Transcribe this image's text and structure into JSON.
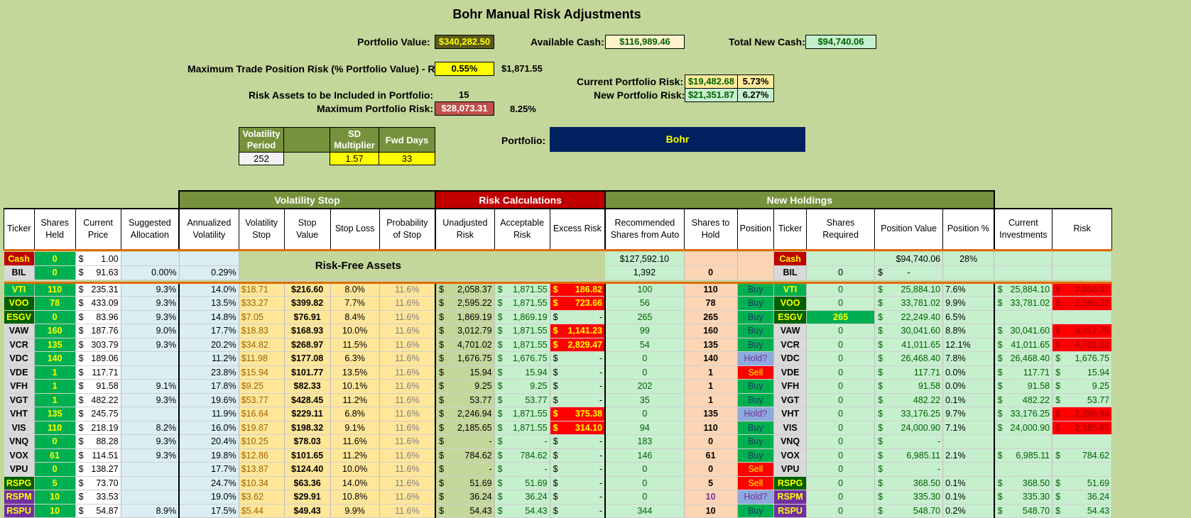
{
  "title": "Bohr Manual Risk Adjustments",
  "top": {
    "portfolio_value_label": "Portfolio Value:",
    "portfolio_value": "$340,282.50",
    "available_cash_label": "Available Cash:",
    "available_cash": "$116,989.46",
    "total_new_cash_label": "Total New Cash:",
    "total_new_cash": "$94,740.06",
    "max_trade_risk_label": "Maximum Trade Position Risk (% Portfolio Value) - R:",
    "max_trade_risk_pct": "0.55%",
    "max_trade_risk_amt": "$1,871.55",
    "current_risk_label": "Current Portfolio Risk:",
    "current_risk_amt": "$19,482.68",
    "current_risk_pct": "5.73%",
    "new_risk_label": "New Portfolio Risk:",
    "new_risk_amt": "$21,351.87",
    "new_risk_pct": "6.27%",
    "risk_assets_label": "Risk Assets to be Included in Portfolio:",
    "risk_assets": "15",
    "max_portfolio_risk_label": "Maximum Portfolio Risk:",
    "max_portfolio_risk_amt": "$28,073.31",
    "max_portfolio_risk_pct": "8.25%",
    "portfolio_label": "Portfolio:",
    "portfolio_name": "Bohr"
  },
  "vol_params": {
    "h_period": "Volatility Period",
    "h_sd": "SD Multiplier",
    "h_fwd": "Fwd Days",
    "period": "252",
    "sd": "1.57",
    "fwd": "33"
  },
  "groups": {
    "volatility_stop": "Volatility Stop",
    "risk_calc": "Risk Calculations",
    "new_holdings": "New Holdings",
    "risk_free": "Risk-Free Assets"
  },
  "headers": [
    "Ticker",
    "Shares Held",
    "Current Price",
    "Suggested Allocation",
    "Annualized Volatility",
    "Volatility Stop",
    "Stop Value",
    "Stop Loss",
    "Probability of Stop",
    "Unadjusted Risk",
    "Acceptable Risk",
    "Excess Risk",
    "Recommended Shares from Auto",
    "Shares to Hold",
    "Position",
    "Ticker",
    "Shares Required",
    "Position Value",
    "Position %",
    "Current Investments",
    "Risk"
  ],
  "cash_row": {
    "ticker": "Cash",
    "shares": "0",
    "price": "1.00",
    "rec": "$127,592.10",
    "ticker2": "Cash",
    "pos_value": "$94,740.06",
    "pos_pct": "28%"
  },
  "bil_row": {
    "ticker": "BIL",
    "shares": "0",
    "price": "91.63",
    "alloc": "0.00%",
    "vol": "0.29%",
    "rec": "1,392",
    "hold": "0",
    "ticker2": "BIL",
    "req": "0",
    "pos_value": "-"
  },
  "rows": [
    {
      "t": "VTI",
      "s": "110",
      "p": "235.31",
      "a": "9.3%",
      "v": "14.0%",
      "vs": "$18.71",
      "sv": "$216.60",
      "sl": "8.0%",
      "pr": "11.6%",
      "ur": "2,058.37",
      "ar": "1,871.55",
      "er": "186.82",
      "rec": "100",
      "h": "110",
      "pos": "Buy",
      "req": "0",
      "pv": "25,884.10",
      "pp": "7.6%",
      "ci": "25,884.10",
      "rk": "2,058.37"
    },
    {
      "t": "VOO",
      "s": "78",
      "p": "433.09",
      "a": "9.3%",
      "v": "13.5%",
      "vs": "$33.27",
      "sv": "$399.82",
      "sl": "7.7%",
      "pr": "11.6%",
      "ur": "2,595.22",
      "ar": "1,871.55",
      "er": "723.66",
      "rec": "56",
      "h": "78",
      "pos": "Buy",
      "req": "0",
      "pv": "33,781.02",
      "pp": "9.9%",
      "ci": "33,781.02",
      "rk": "2,595.22"
    },
    {
      "t": "ESGV",
      "s": "0",
      "p": "83.96",
      "a": "9.3%",
      "v": "14.8%",
      "vs": "$7.05",
      "sv": "$76.91",
      "sl": "8.4%",
      "pr": "11.6%",
      "ur": "1,869.19",
      "ar": "1,869.19",
      "er": "-",
      "rec": "265",
      "h": "265",
      "pos": "Buy",
      "req": "265",
      "pv": "22,249.40",
      "pp": "6.5%",
      "ci": "",
      "rk": ""
    },
    {
      "t": "VAW",
      "s": "160",
      "p": "187.76",
      "a": "9.0%",
      "v": "17.7%",
      "vs": "$18.83",
      "sv": "$168.93",
      "sl": "10.0%",
      "pr": "11.6%",
      "ur": "3,012.79",
      "ar": "1,871.55",
      "er": "1,141.23",
      "rec": "99",
      "h": "160",
      "pos": "Buy",
      "req": "0",
      "pv": "30,041.60",
      "pp": "8.8%",
      "ci": "30,041.60",
      "rk": "3,012.79"
    },
    {
      "t": "VCR",
      "s": "135",
      "p": "303.79",
      "a": "9.3%",
      "v": "20.2%",
      "vs": "$34.82",
      "sv": "$268.97",
      "sl": "11.5%",
      "pr": "11.6%",
      "ur": "4,701.02",
      "ar": "1,871.55",
      "er": "2,829.47",
      "rec": "54",
      "h": "135",
      "pos": "Buy",
      "req": "0",
      "pv": "41,011.65",
      "pp": "12.1%",
      "ci": "41,011.65",
      "rk": "4,701.02"
    },
    {
      "t": "VDC",
      "s": "140",
      "p": "189.06",
      "a": "",
      "v": "11.2%",
      "vs": "$11.98",
      "sv": "$177.08",
      "sl": "6.3%",
      "pr": "11.6%",
      "ur": "1,676.75",
      "ar": "1,676.75",
      "er": "-",
      "rec": "0",
      "h": "140",
      "pos": "Hold?",
      "req": "0",
      "pv": "26,468.40",
      "pp": "7.8%",
      "ci": "26,468.40",
      "rk": "1,676.75"
    },
    {
      "t": "VDE",
      "s": "1",
      "p": "117.71",
      "a": "",
      "v": "23.8%",
      "vs": "$15.94",
      "sv": "$101.77",
      "sl": "13.5%",
      "pr": "11.6%",
      "ur": "15.94",
      "ar": "15.94",
      "er": "-",
      "rec": "0",
      "h": "1",
      "pos": "Sell",
      "req": "0",
      "pv": "117.71",
      "pp": "0.0%",
      "ci": "117.71",
      "rk": "15.94"
    },
    {
      "t": "VFH",
      "s": "1",
      "p": "91.58",
      "a": "9.1%",
      "v": "17.8%",
      "vs": "$9.25",
      "sv": "$82.33",
      "sl": "10.1%",
      "pr": "11.6%",
      "ur": "9.25",
      "ar": "9.25",
      "er": "-",
      "rec": "202",
      "h": "1",
      "pos": "Buy",
      "req": "0",
      "pv": "91.58",
      "pp": "0.0%",
      "ci": "91.58",
      "rk": "9.25"
    },
    {
      "t": "VGT",
      "s": "1",
      "p": "482.22",
      "a": "9.3%",
      "v": "19.6%",
      "vs": "$53.77",
      "sv": "$428.45",
      "sl": "11.2%",
      "pr": "11.6%",
      "ur": "53.77",
      "ar": "53.77",
      "er": "-",
      "rec": "35",
      "h": "1",
      "pos": "Buy",
      "req": "0",
      "pv": "482.22",
      "pp": "0.1%",
      "ci": "482.22",
      "rk": "53.77"
    },
    {
      "t": "VHT",
      "s": "135",
      "p": "245.75",
      "a": "",
      "v": "11.9%",
      "vs": "$16.64",
      "sv": "$229.11",
      "sl": "6.8%",
      "pr": "11.6%",
      "ur": "2,246.94",
      "ar": "1,871.55",
      "er": "375.38",
      "rec": "0",
      "h": "135",
      "pos": "Hold?",
      "req": "0",
      "pv": "33,176.25",
      "pp": "9.7%",
      "ci": "33,176.25",
      "rk": "2,246.94"
    },
    {
      "t": "VIS",
      "s": "110",
      "p": "218.19",
      "a": "8.2%",
      "v": "16.0%",
      "vs": "$19.87",
      "sv": "$198.32",
      "sl": "9.1%",
      "pr": "11.6%",
      "ur": "2,185.65",
      "ar": "1,871.55",
      "er": "314.10",
      "rec": "94",
      "h": "110",
      "pos": "Buy",
      "req": "0",
      "pv": "24,000.90",
      "pp": "7.1%",
      "ci": "24,000.90",
      "rk": "2,185.65"
    },
    {
      "t": "VNQ",
      "s": "0",
      "p": "88.28",
      "a": "9.3%",
      "v": "20.4%",
      "vs": "$10.25",
      "sv": "$78.03",
      "sl": "11.6%",
      "pr": "11.6%",
      "ur": "-",
      "ar": "-",
      "er": "-",
      "rec": "183",
      "h": "0",
      "pos": "Buy",
      "req": "0",
      "pv": "-",
      "pp": "",
      "ci": "",
      "rk": ""
    },
    {
      "t": "VOX",
      "s": "61",
      "p": "114.51",
      "a": "9.3%",
      "v": "19.8%",
      "vs": "$12.86",
      "sv": "$101.65",
      "sl": "11.2%",
      "pr": "11.6%",
      "ur": "784.62",
      "ar": "784.62",
      "er": "-",
      "rec": "146",
      "h": "61",
      "pos": "Buy",
      "req": "0",
      "pv": "6,985.11",
      "pp": "2.1%",
      "ci": "6,985.11",
      "rk": "784.62"
    },
    {
      "t": "VPU",
      "s": "0",
      "p": "138.27",
      "a": "",
      "v": "17.7%",
      "vs": "$13.87",
      "sv": "$124.40",
      "sl": "10.0%",
      "pr": "11.6%",
      "ur": "-",
      "ar": "-",
      "er": "-",
      "rec": "0",
      "h": "0",
      "pos": "Sell",
      "req": "0",
      "pv": "-",
      "pp": "",
      "ci": "",
      "rk": ""
    },
    {
      "t": "RSPG",
      "s": "5",
      "p": "73.70",
      "a": "",
      "v": "24.7%",
      "vs": "$10.34",
      "sv": "$63.36",
      "sl": "14.0%",
      "pr": "11.6%",
      "ur": "51.69",
      "ar": "51.69",
      "er": "-",
      "rec": "0",
      "h": "5",
      "pos": "Sell",
      "req": "0",
      "pv": "368.50",
      "pp": "0.1%",
      "ci": "368.50",
      "rk": "51.69"
    },
    {
      "t": "RSPM",
      "s": "10",
      "p": "33.53",
      "a": "",
      "v": "19.0%",
      "vs": "$3.62",
      "sv": "$29.91",
      "sl": "10.8%",
      "pr": "11.6%",
      "ur": "36.24",
      "ar": "36.24",
      "er": "-",
      "rec": "0",
      "h": "10",
      "pos": "Hold?",
      "req": "0",
      "pv": "335.30",
      "pp": "0.1%",
      "ci": "335.30",
      "rk": "36.24"
    },
    {
      "t": "RSPU",
      "s": "10",
      "p": "54.87",
      "a": "8.9%",
      "v": "17.5%",
      "vs": "$5.44",
      "sv": "$49.43",
      "sl": "9.9%",
      "pr": "11.6%",
      "ur": "54.43",
      "ar": "54.43",
      "er": "-",
      "rec": "344",
      "h": "10",
      "pos": "Buy",
      "req": "0",
      "pv": "548.70",
      "pp": "0.2%",
      "ci": "548.70",
      "rk": "54.43"
    }
  ],
  "colors": {
    "background": "#c4d79b",
    "navy": "#002060",
    "red_header": "#c00000",
    "olive_header": "#76923c"
  }
}
